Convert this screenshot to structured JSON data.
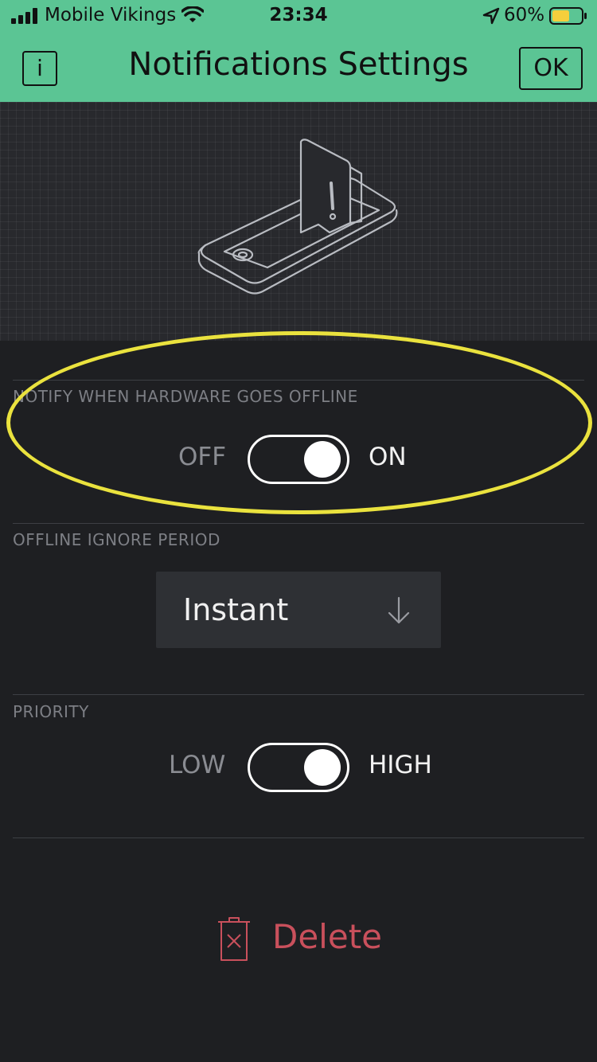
{
  "status_bar": {
    "carrier": "Mobile Vikings",
    "time": "23:34",
    "battery_percent": "60%",
    "battery_level": 0.6,
    "icons": [
      "signal-icon",
      "wifi-icon",
      "location-arrow-icon",
      "battery-icon"
    ]
  },
  "header": {
    "info_label": "i",
    "title": "Notifications Settings",
    "ok_label": "OK",
    "background_color": "#5bc594"
  },
  "hero": {
    "illustration": "phone-notification-icon"
  },
  "notify_offline": {
    "section_label": "NOTIFY WHEN HARDWARE GOES OFFLINE",
    "off_label": "OFF",
    "on_label": "ON",
    "enabled": true
  },
  "ignore_period": {
    "section_label": "OFFLINE IGNORE PERIOD",
    "selected": "Instant"
  },
  "priority": {
    "section_label": "PRIORITY",
    "low_label": "LOW",
    "high_label": "HIGH",
    "high_selected": true
  },
  "delete": {
    "label": "Delete",
    "color": "#c9505c"
  },
  "annotation": {
    "highlight_color": "#eae23e"
  }
}
